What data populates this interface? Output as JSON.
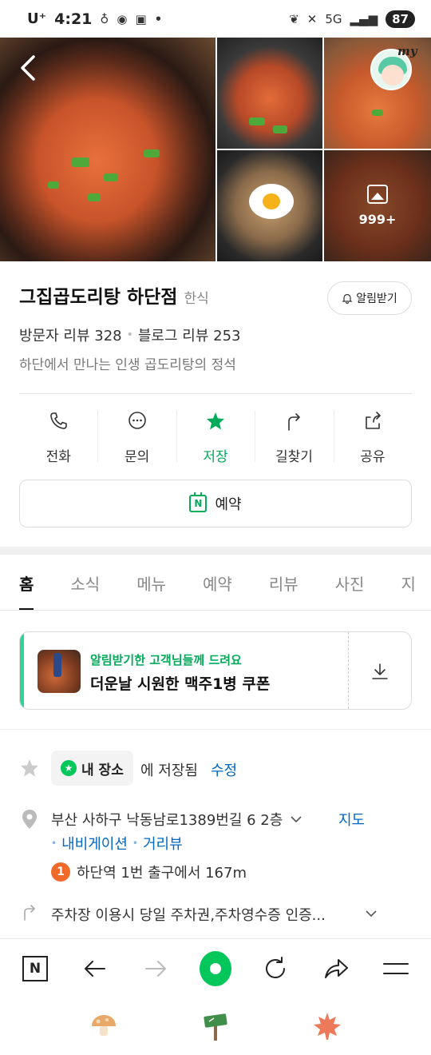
{
  "status_bar": {
    "carrier": "U⁺",
    "time": "4:21",
    "battery": "87",
    "network": "5G"
  },
  "photos": {
    "more_count": "999+"
  },
  "place": {
    "name": "그집곱도리탕 하단점",
    "category": "한식",
    "alarm_label": "알림받기",
    "visitor_reviews": "방문자 리뷰 328",
    "blog_reviews": "블로그 리뷰 253",
    "description": "하단에서 만나는 인생 곱도리탕의 정석"
  },
  "actions": [
    {
      "label": "전화",
      "icon": "phone-icon"
    },
    {
      "label": "문의",
      "icon": "chat-icon"
    },
    {
      "label": "저장",
      "icon": "star-icon"
    },
    {
      "label": "길찾기",
      "icon": "directions-icon"
    },
    {
      "label": "공유",
      "icon": "share-icon"
    }
  ],
  "reserve_label": "예약",
  "tabs": [
    "홈",
    "소식",
    "메뉴",
    "예약",
    "리뷰",
    "사진",
    "지"
  ],
  "coupon": {
    "subtitle": "알림받기한 고객님들께 드려요",
    "title": "더운날 시원한 맥주1병 쿠폰"
  },
  "details": {
    "my_place": "내 장소",
    "saved_text": "에 저장됨",
    "edit_link": "수정",
    "address": "부산 사하구 낙동남로1389번길 6 2층",
    "map_link": "지도",
    "nav_link": "내비게이션",
    "street_link": "거리뷰",
    "station_num": "1",
    "station": "하단역 1번 출구에서 167m",
    "parking": "주차장 이용시 당일 주차권,주차영수증 인증..."
  },
  "colors": {
    "accent_green": "#03aa5a",
    "link_blue": "#0068c3",
    "coupon_bar": "#2fd597",
    "station_badge": "#f06a2a"
  }
}
